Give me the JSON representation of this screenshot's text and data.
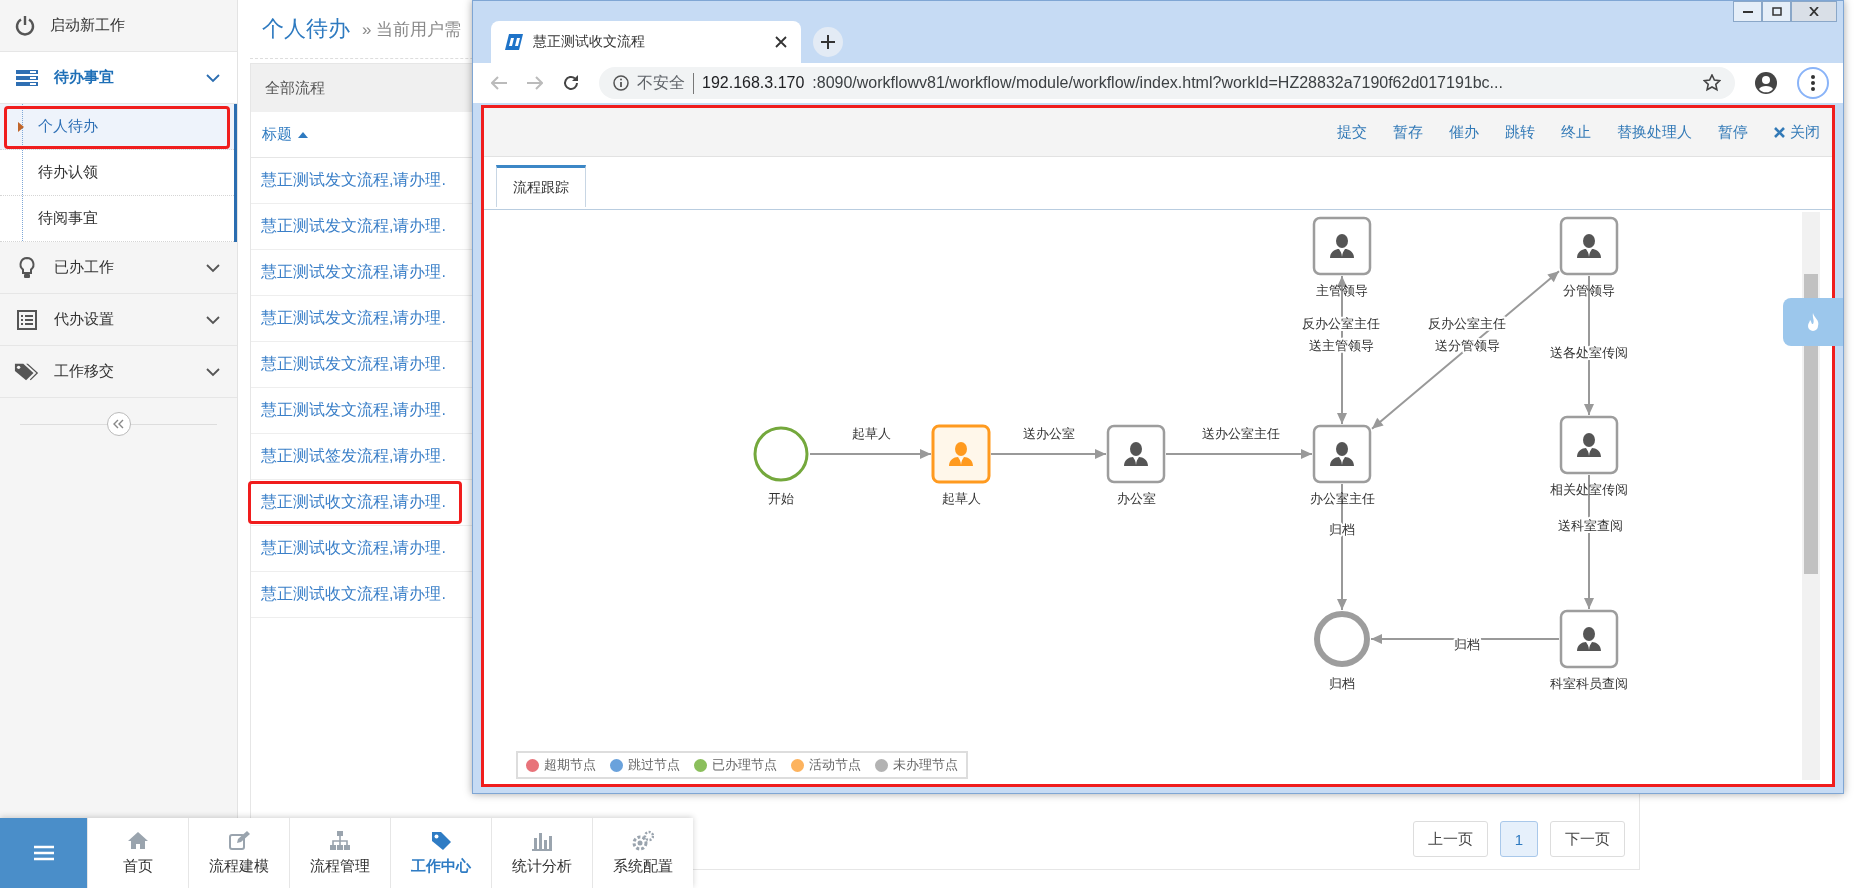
{
  "sidebar": {
    "start_item": {
      "label": "启动新工作"
    },
    "sections": [
      {
        "label": "待办事宜",
        "expanded": true,
        "children": [
          {
            "label": "个人待办",
            "selected": true,
            "highlighted": true
          },
          {
            "label": "待办认领",
            "selected": false,
            "highlighted": false
          },
          {
            "label": "待阅事宜",
            "selected": false,
            "highlighted": false
          }
        ]
      },
      {
        "label": "已办工作",
        "expanded": false
      },
      {
        "label": "代办设置",
        "expanded": false
      },
      {
        "label": "工作移交",
        "expanded": false
      }
    ]
  },
  "page": {
    "title": "个人待办",
    "breadcrumb": "» 当前用户需"
  },
  "list": {
    "filter_tab": "全部流程",
    "column": {
      "label": "标题",
      "sorted_ascending": true
    },
    "rows": [
      {
        "title": "慧正测试发文流程,请办理.",
        "highlighted": false
      },
      {
        "title": "慧正测试发文流程,请办理.",
        "highlighted": false
      },
      {
        "title": "慧正测试发文流程,请办理.",
        "highlighted": false
      },
      {
        "title": "慧正测试发文流程,请办理.",
        "highlighted": false
      },
      {
        "title": "慧正测试发文流程,请办理.",
        "highlighted": false
      },
      {
        "title": "慧正测试发文流程,请办理.",
        "highlighted": false
      },
      {
        "title": "慧正测试签发流程,请办理.",
        "highlighted": false
      },
      {
        "title": "慧正测试收文流程,请办理.",
        "highlighted": true
      },
      {
        "title": "慧正测试收文流程,请办理.",
        "highlighted": false
      },
      {
        "title": "慧正测试收文流程,请办理.",
        "highlighted": false
      }
    ]
  },
  "pager": {
    "prev": "上一页",
    "pages": [
      {
        "label": "1",
        "selected": true
      }
    ],
    "next": "下一页"
  },
  "bottom_nav": {
    "items": [
      {
        "label": "首页",
        "selected": false
      },
      {
        "label": "流程建模",
        "selected": false
      },
      {
        "label": "流程管理",
        "selected": false
      },
      {
        "label": "工作中心",
        "selected": true
      },
      {
        "label": "统计分析",
        "selected": false
      },
      {
        "label": "系统配置",
        "selected": false
      }
    ]
  },
  "window": {
    "tab_title": "慧正测试收文流程",
    "address": {
      "security": "不安全",
      "host": "192.168.3.170",
      "path": ":8090/workflowv81/workflow/module/workflow/index.html?workId=HZ28832a7190f62d017191bc..."
    },
    "content_highlighted": true,
    "toolbar": [
      {
        "label": "提交",
        "kind": "text"
      },
      {
        "label": "暂存",
        "kind": "text"
      },
      {
        "label": "催办",
        "kind": "text"
      },
      {
        "label": "跳转",
        "kind": "text"
      },
      {
        "label": "终止",
        "kind": "text"
      },
      {
        "label": "替换处理人",
        "kind": "text"
      },
      {
        "label": "暂停",
        "kind": "text"
      },
      {
        "label": "关闭",
        "kind": "close"
      }
    ],
    "tabs": [
      {
        "label": "流程跟踪",
        "selected": true
      }
    ],
    "diagram": {
      "nodes": [
        {
          "label": "主管领导",
          "kind": "task",
          "completed": false,
          "active": false
        },
        {
          "label": "分管领导",
          "kind": "task",
          "completed": false,
          "active": false
        },
        {
          "label": "开始",
          "kind": "start",
          "completed": true,
          "active": false
        },
        {
          "label": "起草人",
          "kind": "task",
          "completed": false,
          "active": true
        },
        {
          "label": "办公室",
          "kind": "task",
          "completed": false,
          "active": false
        },
        {
          "label": "办公室主任",
          "kind": "task",
          "completed": false,
          "active": false
        },
        {
          "label": "相关处室传阅",
          "kind": "task",
          "completed": false,
          "active": false
        },
        {
          "label": "归档",
          "kind": "end",
          "completed": false,
          "active": false
        },
        {
          "label": "科室科员查阅",
          "kind": "task",
          "completed": false,
          "active": false
        }
      ],
      "edges": [
        {
          "label_lines": [
            "反办公室主任",
            "送主管领导"
          ],
          "two_way": true
        },
        {
          "label_lines": [
            "反办公室主任",
            "送分管领导"
          ],
          "two_way": true
        },
        {
          "label_lines": [
            "送各处室传阅"
          ],
          "two_way": false
        },
        {
          "label_lines": [
            "起草人"
          ],
          "two_way": false
        },
        {
          "label_lines": [
            "送办公室"
          ],
          "two_way": false
        },
        {
          "label_lines": [
            "送办公室主任"
          ],
          "two_way": false
        },
        {
          "label_lines": [
            "送科室查阅"
          ],
          "two_way": false
        },
        {
          "label_lines": [
            "归档"
          ],
          "two_way": false
        },
        {
          "label_lines": [
            "归档"
          ],
          "two_way": false
        }
      ],
      "legend": [
        {
          "label": "超期节点",
          "color": "#e8737a"
        },
        {
          "label": "跳过节点",
          "color": "#6aa2dc"
        },
        {
          "label": "已办理节点",
          "color": "#8bbf5c"
        },
        {
          "label": "活动节点",
          "color": "#fdb35e"
        },
        {
          "label": "未办理节点",
          "color": "#b3b3b3"
        }
      ]
    }
  }
}
